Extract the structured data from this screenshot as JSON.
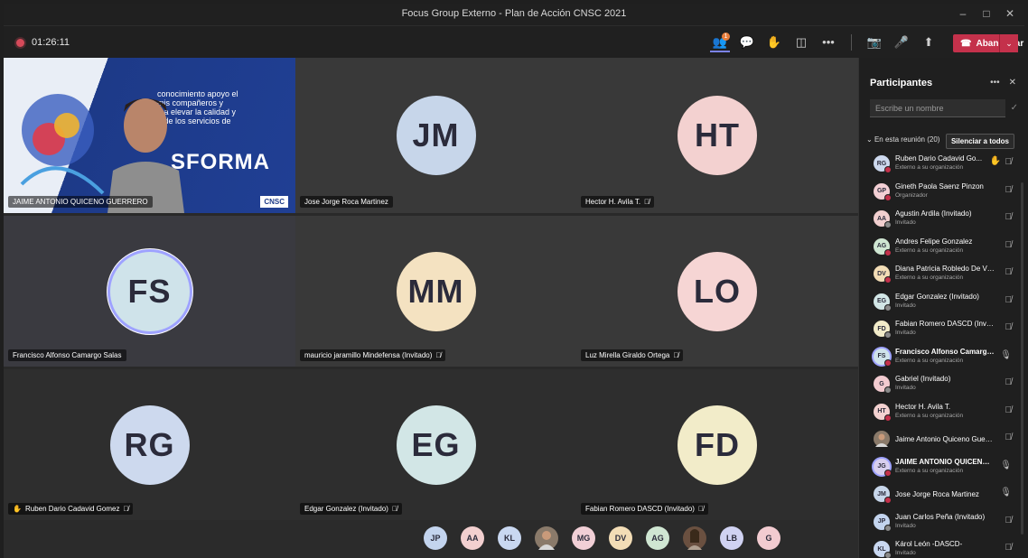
{
  "window": {
    "title": "Focus Group Externo - Plan de Acción CNSC 2021",
    "minimize": "–",
    "maximize": "□",
    "close": "✕"
  },
  "toolbar": {
    "timer": "01:26:11",
    "participants_badge": "1",
    "leave_label": "Abandonar",
    "caret": "⌄",
    "icons": {
      "people": "👥",
      "chat": "💬",
      "hand": "✋",
      "rooms": "◫",
      "more": "•••",
      "camera": "📷",
      "mic": "🎤",
      "share": "⬆",
      "phone": "☎"
    }
  },
  "tiles": [
    {
      "name": "JAIME ANTONIO QUICENO GUERRERO",
      "video": true,
      "video_text": [
        "conocimiento apoyo el",
        "mis compañeros y",
        "o a elevar la calidad y",
        "a de los servicios de"
      ],
      "video_big": "SFORMA",
      "logo": "CNSC"
    },
    {
      "initials": "JM",
      "name": "Jose Jorge Roca Martinez",
      "color": "#c7d6ea",
      "muted": false
    },
    {
      "initials": "HT",
      "name": "Hector H. Avila T.",
      "color": "#f3d1d0",
      "muted": true
    },
    {
      "initials": "FS",
      "name": "Francisco Alfonso Camargo Salas",
      "color": "#cfe3ea",
      "muted": false,
      "speaking": true
    },
    {
      "initials": "MM",
      "name": "mauricio jaramillo Mindefensa (Invitado)",
      "color": "#f4e2c1",
      "muted": true
    },
    {
      "initials": "LO",
      "name": "Luz Mirella Giraldo Ortega",
      "color": "#f6d5d4",
      "muted": true
    },
    {
      "initials": "RG",
      "name": "Ruben Dario Cadavid Gomez",
      "color": "#cdd9ee",
      "muted": true,
      "hand": true
    },
    {
      "initials": "EG",
      "name": "Edgar Gonzalez (Invitado)",
      "color": "#d2e6e6",
      "muted": true
    },
    {
      "initials": "FD",
      "name": "Fabian Romero DASCD (Invitado)",
      "color": "#f2ecc9",
      "muted": true
    }
  ],
  "tray": [
    {
      "initials": "JP",
      "color": "#c3d4ee"
    },
    {
      "initials": "AA",
      "color": "#f2cfcf"
    },
    {
      "initials": "KL",
      "color": "#c9d8f1"
    },
    {
      "initials": "",
      "color": "#8a7a6a",
      "photo": true
    },
    {
      "initials": "MG",
      "color": "#f1cfd6"
    },
    {
      "initials": "DV",
      "color": "#f3ddb6"
    },
    {
      "initials": "AG",
      "color": "#cfe6d2"
    },
    {
      "initials": "",
      "color": "#6a5040",
      "photo": true
    },
    {
      "initials": "LB",
      "color": "#d0d2f2"
    },
    {
      "initials": "G",
      "color": "#f2cbd0"
    }
  ],
  "panel": {
    "title": "Participantes",
    "more": "•••",
    "close": "✕",
    "search_placeholder": "Escribe un nombre",
    "section_label": "En esta reunión (20)",
    "mute_all": "Silenciar a todos",
    "items": [
      {
        "initials": "RG",
        "name": "Ruben Dario Cadavid Go...",
        "role": "Externo a su organización",
        "color": "#cdd9ee",
        "hand": true,
        "mic": "muted",
        "dot": "red"
      },
      {
        "initials": "GP",
        "name": "Gineth Paola Saenz Pinzon",
        "role": "Organizador",
        "color": "#f3cfd4",
        "mic": "muted",
        "dot": "red"
      },
      {
        "initials": "AA",
        "name": "Agustin Ardila (Invitado)",
        "role": "Invitado",
        "color": "#f2cfcf",
        "mic": "muted",
        "dot": "grey"
      },
      {
        "initials": "AG",
        "name": "Andres Felipe Gonzalez",
        "role": "Externo a su organización",
        "color": "#cfe6d2",
        "mic": "muted",
        "dot": "red"
      },
      {
        "initials": "DV",
        "name": "Diana Patricia Robledo De Villa",
        "role": "Externo a su organización",
        "color": "#f3ddb6",
        "mic": "muted",
        "dot": "red"
      },
      {
        "initials": "EG",
        "name": "Edgar Gonzalez (Invitado)",
        "role": "Invitado",
        "color": "#d2e6e6",
        "mic": "muted",
        "dot": "grey"
      },
      {
        "initials": "FD",
        "name": "Fabian Romero DASCD (Invita...",
        "role": "Invitado",
        "color": "#f2ecc9",
        "mic": "muted",
        "dot": "grey"
      },
      {
        "initials": "FS",
        "name": "Francisco Alfonso Camargo S...",
        "role": "Externo a su organización",
        "color": "#cfe3ea",
        "mic": "on",
        "dot": "red",
        "highlight": true,
        "bold": true
      },
      {
        "initials": "G",
        "name": "Gabriel (Invitado)",
        "role": "Invitado",
        "color": "#f2cbd0",
        "mic": "muted",
        "dot": "grey"
      },
      {
        "initials": "HT",
        "name": "Hector H. Avila T.",
        "role": "Externo a su organización",
        "color": "#f3d1d0",
        "mic": "muted",
        "dot": "red"
      },
      {
        "initials": "",
        "name": "Jaime Antonio Quiceno Guerr...",
        "role": "",
        "color": "#8a7a6a",
        "mic": "muted",
        "photo": true
      },
      {
        "initials": "JG",
        "name": "JAIME ANTONIO QUICENO ...",
        "role": "Externo a su organización",
        "color": "#d8cfee",
        "mic": "on",
        "dot": "red",
        "highlight": true,
        "bold": true
      },
      {
        "initials": "JM",
        "name": "Jose Jorge Roca Martinez",
        "role": "",
        "color": "#c7d6ea",
        "mic": "on",
        "dot": "red"
      },
      {
        "initials": "JP",
        "name": "Juan Carlos Peña (Invitado)",
        "role": "Invitado",
        "color": "#c3d4ee",
        "mic": "muted",
        "dot": "grey"
      },
      {
        "initials": "KL",
        "name": "Károl León -DASCD-",
        "role": "Invitado",
        "color": "#c9d8f1",
        "mic": "muted",
        "dot": "grey"
      }
    ]
  }
}
